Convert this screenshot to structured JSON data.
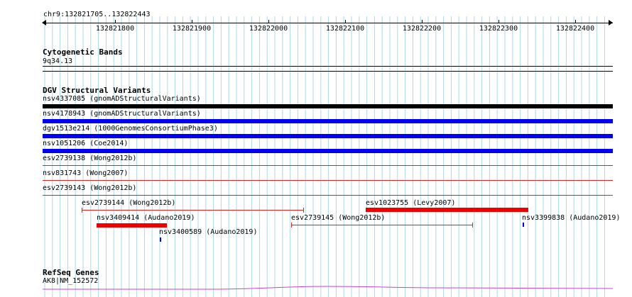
{
  "locus": "chr9:132821705..132822443",
  "ruler": {
    "ticks": [
      "132821800",
      "132821900",
      "132822000",
      "132822100",
      "132822200",
      "132822300",
      "132822400"
    ]
  },
  "cytoband": {
    "title": "Cytogenetic Bands",
    "label": "9q34.13"
  },
  "dgv": {
    "title": "DGV Structural Variants",
    "rows": [
      {
        "label": "nsv4337085 (gnomADStructuralVariants)",
        "color": "#000000",
        "style": "thick"
      },
      {
        "label": "nsv4178943 (gnomADStructuralVariants)",
        "color": "#0000ee",
        "style": "thick"
      },
      {
        "label": "dgv1513e214 (1000GenomesConsortiumPhase3)",
        "color": "#0000ee",
        "style": "thick"
      },
      {
        "label": "nsv1051206 (Coe2014)",
        "color": "#0000ee",
        "style": "thick"
      },
      {
        "label": "esv2739138 (Wong2012b)",
        "color": "#dd2222",
        "style": "thin"
      },
      {
        "label": "nsv831743 (Wong2007)",
        "color": "#dd2222",
        "style": "thin"
      },
      {
        "label": "esv2739143 (Wong2012b)",
        "color": "#dd2222",
        "style": "thin"
      }
    ],
    "small_features": [
      {
        "label": "esv2739144 (Wong2012b)",
        "color": "#dd2222",
        "style": "bracket"
      },
      {
        "label": "esv1023755 (Levy2007)",
        "color": "#ee0000",
        "style": "thick"
      },
      {
        "label": "nsv3409414 (Audano2019)",
        "color": "#ee0000",
        "style": "thick"
      },
      {
        "label": "esv2739145 (Wong2012b)",
        "color": "#dd2222",
        "style": "bracket"
      },
      {
        "label": "nsv3399838 (Audano2019)",
        "color": "#0000ee",
        "style": "tick"
      },
      {
        "label": "nsv3400589 (Audano2019)",
        "color": "#0000ee",
        "style": "tick"
      }
    ]
  },
  "refseq": {
    "title": "RefSeq Genes",
    "label": "AK8|NM_152572",
    "color": "#cc44cc"
  },
  "colors": {
    "grid": "#add8e6",
    "separator": "#000000"
  }
}
